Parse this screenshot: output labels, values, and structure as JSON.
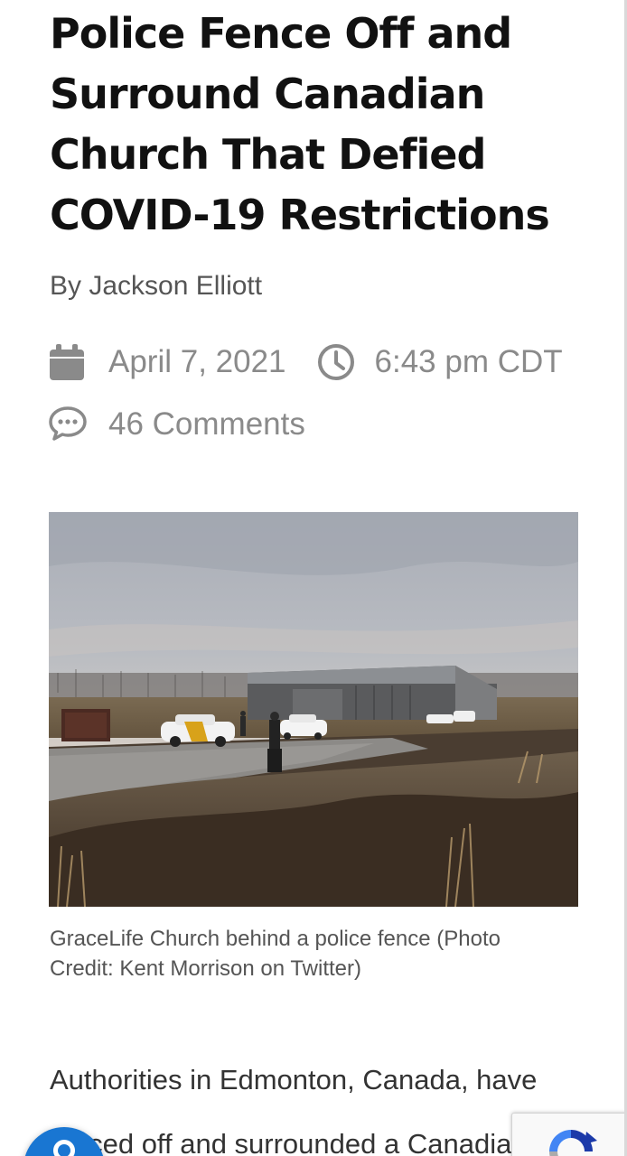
{
  "article": {
    "title": "Police Fence Off and Surround Canadian Church That Defied COVID-19 Restrictions",
    "byline": "By Jackson Elliott",
    "date": "April 7, 2021",
    "time": "6:43 pm CDT",
    "comments": "46 Comments",
    "photo_caption": "GraceLife Church behind a police fence (Photo Credit: Kent Morrison on Twitter)",
    "body_text": "Authorities in Edmonton, Canada, have fenced off and surrounded a Canadia"
  },
  "icons": {
    "date": "calendar-icon",
    "time": "clock-icon",
    "comments": "speech-bubble-icon",
    "floating_left": "accessibility-button-icon",
    "recaptcha": "recaptcha-icon"
  },
  "colors": {
    "headline": "#111111",
    "meta_gray": "#8a8a8a",
    "caption_gray": "#555555",
    "floating_button_blue": "#1976d2"
  }
}
